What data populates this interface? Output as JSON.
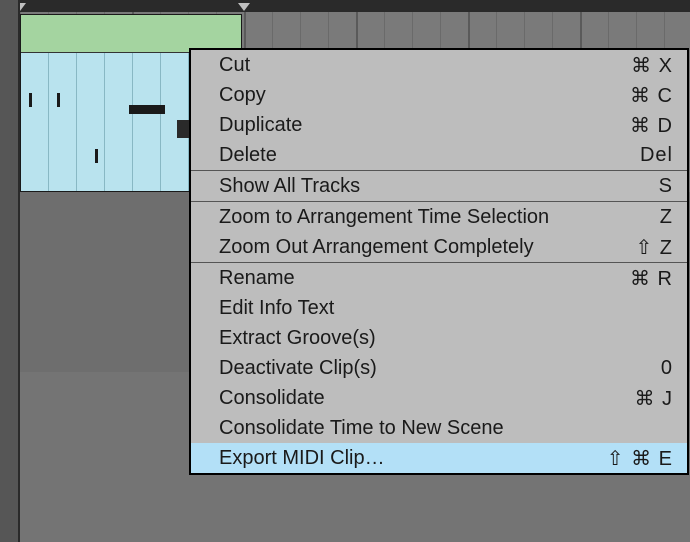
{
  "menu": {
    "items": [
      {
        "label": "Cut",
        "shortcut": "⌘ X"
      },
      {
        "label": "Copy",
        "shortcut": "⌘ C"
      },
      {
        "label": "Duplicate",
        "shortcut": "⌘ D"
      },
      {
        "label": "Delete",
        "shortcut": "Del"
      }
    ],
    "group2": [
      {
        "label": "Show All Tracks",
        "shortcut": "S"
      }
    ],
    "group3": [
      {
        "label": "Zoom to Arrangement Time Selection",
        "shortcut": "Z"
      },
      {
        "label": "Zoom Out Arrangement Completely",
        "shortcut": "⇧ Z"
      }
    ],
    "group4": [
      {
        "label": "Rename",
        "shortcut": "⌘ R"
      },
      {
        "label": "Edit Info Text",
        "shortcut": ""
      },
      {
        "label": "Extract Groove(s)",
        "shortcut": ""
      },
      {
        "label": "Deactivate Clip(s)",
        "shortcut": "0"
      },
      {
        "label": "Consolidate",
        "shortcut": "⌘ J"
      },
      {
        "label": "Consolidate Time to New Scene",
        "shortcut": ""
      },
      {
        "label": "Export MIDI Clip…",
        "shortcut": "⇧ ⌘ E",
        "highlight": true
      }
    ]
  }
}
